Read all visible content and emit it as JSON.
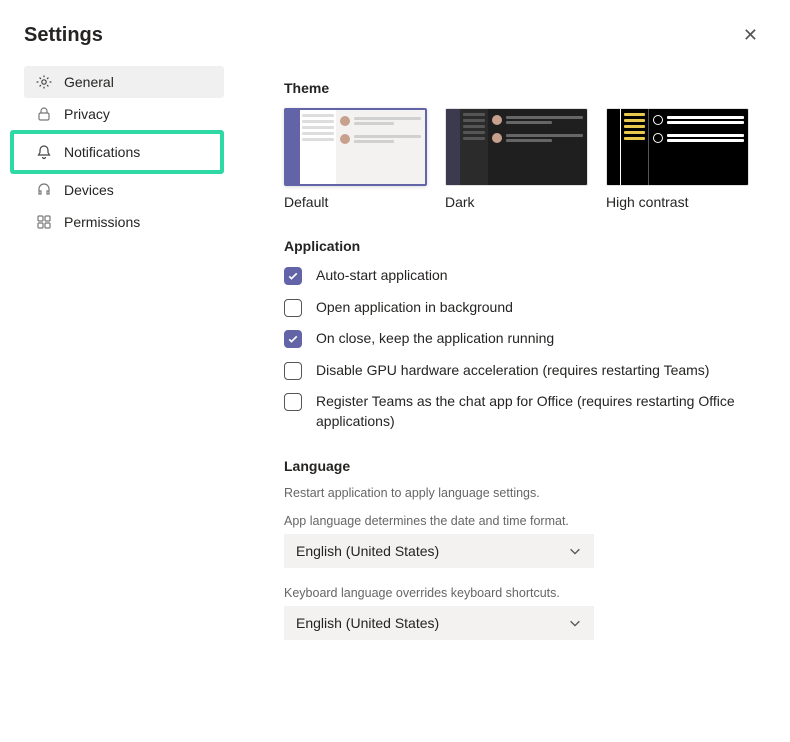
{
  "title": "Settings",
  "sidebar": {
    "items": [
      {
        "label": "General"
      },
      {
        "label": "Privacy"
      },
      {
        "label": "Notifications"
      },
      {
        "label": "Devices"
      },
      {
        "label": "Permissions"
      }
    ]
  },
  "theme": {
    "section_title": "Theme",
    "options": [
      {
        "label": "Default",
        "selected": true
      },
      {
        "label": "Dark",
        "selected": false
      },
      {
        "label": "High contrast",
        "selected": false
      }
    ]
  },
  "application": {
    "section_title": "Application",
    "options": [
      {
        "label": "Auto-start application",
        "checked": true
      },
      {
        "label": "Open application in background",
        "checked": false
      },
      {
        "label": "On close, keep the application running",
        "checked": true
      },
      {
        "label": "Disable GPU hardware acceleration (requires restarting Teams)",
        "checked": false
      },
      {
        "label": "Register Teams as the chat app for Office (requires restarting Office applications)",
        "checked": false
      }
    ]
  },
  "language": {
    "section_title": "Language",
    "restart_hint": "Restart application to apply language settings.",
    "app_lang_label": "App language determines the date and time format.",
    "app_lang_value": "English (United States)",
    "keyboard_label": "Keyboard language overrides keyboard shortcuts.",
    "keyboard_value": "English (United States)"
  }
}
